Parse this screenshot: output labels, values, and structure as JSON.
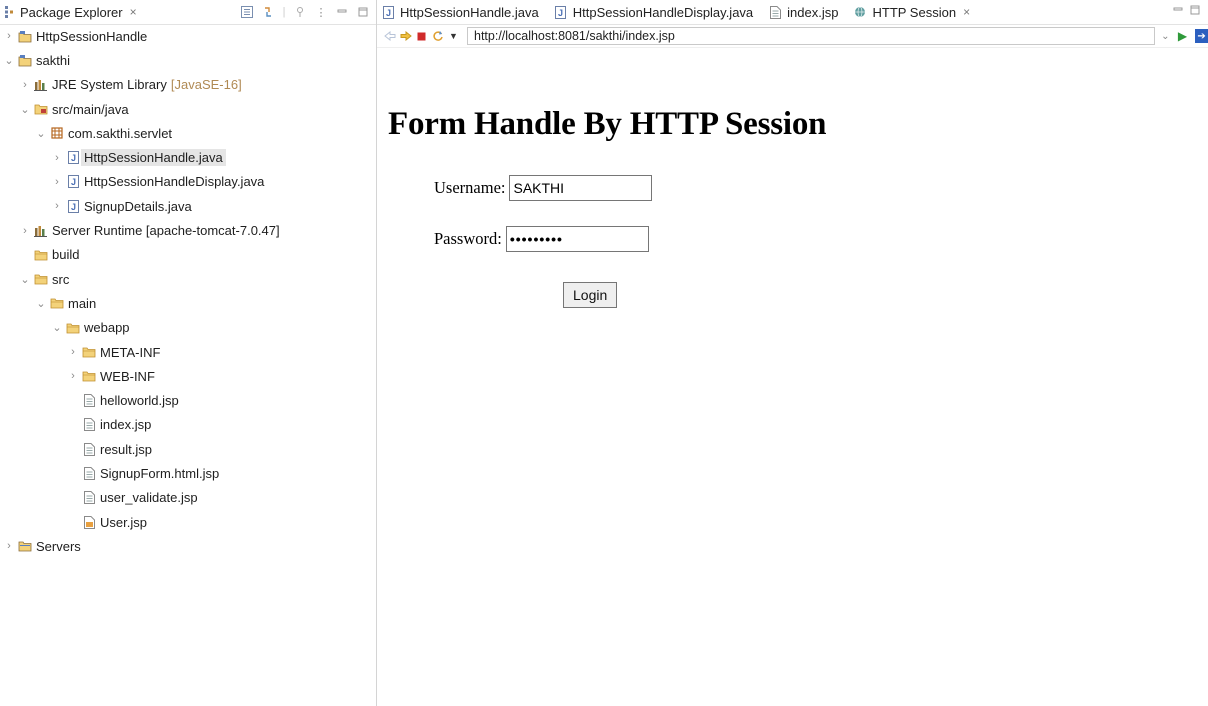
{
  "explorer": {
    "title": "Package Explorer",
    "close": "×",
    "tools": [
      "collapse-all-icon",
      "link-editor-icon",
      "focus-icon",
      "view-menu-icon",
      "minimize-icon",
      "maximize-icon"
    ]
  },
  "tree": [
    {
      "indent": 0,
      "twisty": "›",
      "icon": "project-icon",
      "label": "HttpSessionHandle",
      "decor": ""
    },
    {
      "indent": 0,
      "twisty": "⌄",
      "icon": "project-icon",
      "label": "sakthi",
      "decor": ""
    },
    {
      "indent": 1,
      "twisty": "›",
      "icon": "library-icon",
      "label": "JRE System Library",
      "decor": "[JavaSE-16]"
    },
    {
      "indent": 1,
      "twisty": "⌄",
      "icon": "source-folder-icon",
      "label": "src/main/java",
      "decor": ""
    },
    {
      "indent": 2,
      "twisty": "⌄",
      "icon": "package-icon",
      "label": "com.sakthi.servlet",
      "decor": ""
    },
    {
      "indent": 3,
      "twisty": "›",
      "icon": "java-file-icon",
      "label": "HttpSessionHandle.java",
      "decor": "",
      "selected": true
    },
    {
      "indent": 3,
      "twisty": "›",
      "icon": "java-file-icon",
      "label": "HttpSessionHandleDisplay.java",
      "decor": ""
    },
    {
      "indent": 3,
      "twisty": "›",
      "icon": "java-file-icon",
      "label": "SignupDetails.java",
      "decor": ""
    },
    {
      "indent": 1,
      "twisty": "›",
      "icon": "library-icon",
      "label": "Server Runtime [apache-tomcat-7.0.47]",
      "decor": ""
    },
    {
      "indent": 1,
      "twisty": "",
      "icon": "folder-icon",
      "label": "build",
      "decor": ""
    },
    {
      "indent": 1,
      "twisty": "⌄",
      "icon": "folder-icon",
      "label": "src",
      "decor": ""
    },
    {
      "indent": 2,
      "twisty": "⌄",
      "icon": "folder-icon",
      "label": "main",
      "decor": ""
    },
    {
      "indent": 3,
      "twisty": "⌄",
      "icon": "folder-icon",
      "label": "webapp",
      "decor": ""
    },
    {
      "indent": 4,
      "twisty": "›",
      "icon": "folder-icon",
      "label": "META-INF",
      "decor": ""
    },
    {
      "indent": 4,
      "twisty": "›",
      "icon": "folder-icon",
      "label": "WEB-INF",
      "decor": ""
    },
    {
      "indent": 4,
      "twisty": "",
      "icon": "file-icon",
      "label": "helloworld.jsp",
      "decor": ""
    },
    {
      "indent": 4,
      "twisty": "",
      "icon": "file-icon",
      "label": "index.jsp",
      "decor": ""
    },
    {
      "indent": 4,
      "twisty": "",
      "icon": "file-icon",
      "label": "result.jsp",
      "decor": ""
    },
    {
      "indent": 4,
      "twisty": "",
      "icon": "file-icon",
      "label": "SignupForm.html.jsp",
      "decor": ""
    },
    {
      "indent": 4,
      "twisty": "",
      "icon": "file-icon",
      "label": "user_validate.jsp",
      "decor": ""
    },
    {
      "indent": 4,
      "twisty": "",
      "icon": "jsp-file-icon",
      "label": "User.jsp",
      "decor": ""
    },
    {
      "indent": 0,
      "twisty": "›",
      "icon": "servers-folder-icon",
      "label": "Servers",
      "decor": ""
    }
  ],
  "editor": {
    "tabs": [
      {
        "icon": "java-file-icon",
        "label": "HttpSessionHandle.java"
      },
      {
        "icon": "java-file-icon",
        "label": "HttpSessionHandleDisplay.java"
      },
      {
        "icon": "file-icon",
        "label": "index.jsp"
      },
      {
        "icon": "globe-icon",
        "label": "HTTP Session",
        "close": "×",
        "active": true
      }
    ]
  },
  "browser": {
    "url": "http://localhost:8081/sakthi/index.jsp"
  },
  "page": {
    "heading": "Form Handle By HTTP Session",
    "username_label": "Username:",
    "username_value": "SAKTHI",
    "password_label": "Password:",
    "password_value": "•••••••••",
    "login_label": "Login"
  },
  "colors": {
    "folder": "#e2b04a",
    "java": "#4a6fb5",
    "package": "#b5651d",
    "library": "#8a6d3b",
    "decor": "#b08a54"
  }
}
